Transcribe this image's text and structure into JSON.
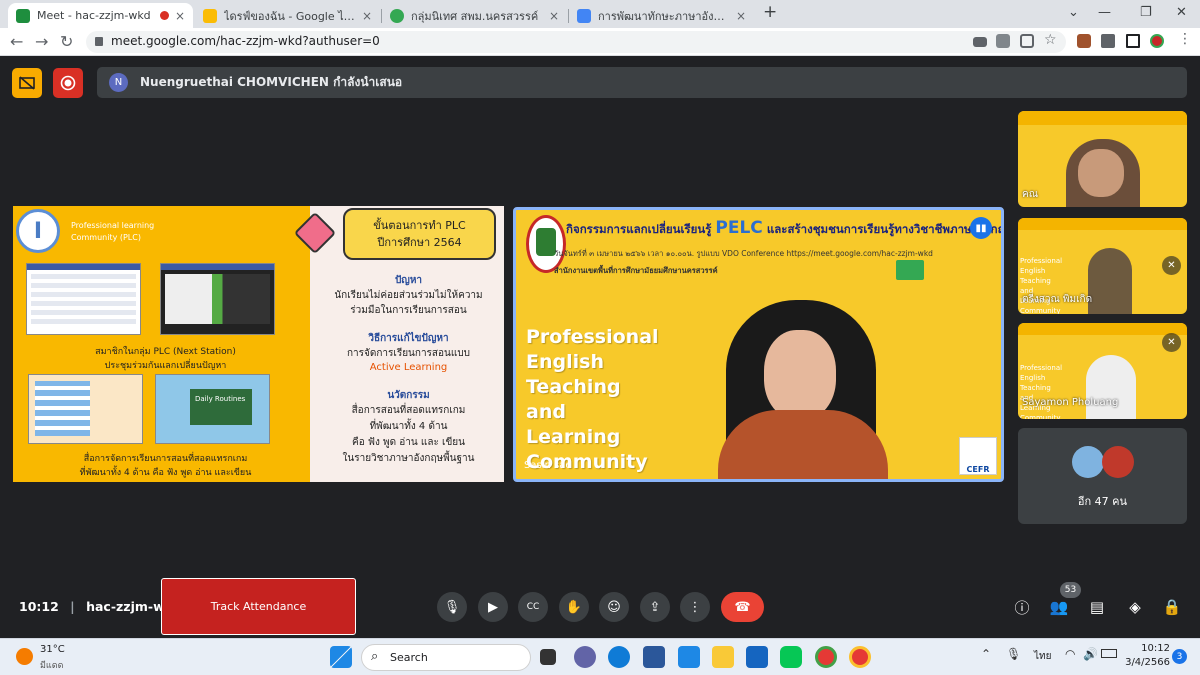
{
  "browser": {
    "tabs": [
      {
        "title": "Meet - hac-zzjm-wkd",
        "active": true,
        "color": "#1e8e3e"
      },
      {
        "title": "ไดรฟ์ของฉัน - Google ไดรฟ์",
        "active": false,
        "color": "#fbbc04"
      },
      {
        "title": "กลุ่มนิเทศ สพม.นครสวรรค์",
        "active": false,
        "color": "#34a853"
      },
      {
        "title": "การพัฒนาทักษะภาษาอังกฤษ English",
        "active": false,
        "color": "#4285f4"
      }
    ],
    "new_tab": "+",
    "close": "×",
    "url": "meet.google.com/hac-zzjm-wkd?authuser=0"
  },
  "meet": {
    "presenter_initial": "N",
    "presenter_text": "Nuengruethai CHOMVICHEN กำลังนำเสนอ",
    "slide": {
      "logo_letter": "I",
      "plc_title": "Professional learning Community (PLC)",
      "caption1": "สมาชิกในกลุ่ม PLC (Next Station)\nประชุมร่วมกันแลกเปลี่ยนปัญหา",
      "caption2": "สื่อการจัดการเรียนการสอนที่สอดแทรกเกม\nที่พัฒนาทั้ง 4 ด้าน คือ ฟัง พูด อ่าน และเขียน",
      "banner": "ขั้นตอนการทำ PLC\nปีการศึกษา 2564",
      "problem_h": "ปัญหา",
      "problem": "นักเรียนไม่ค่อยส่วนร่วมไม่ให้ความ\nร่วมมือในการเรียนการสอน",
      "solution_h": "วิธีการแก้ไขปัญหา",
      "solution": "การจัดการเรียนการสอนแบบ",
      "active_learning": "Active Learning",
      "innovation_h": "นวัตกรรม",
      "innovation": "สื่อการสอนที่สอดแทรกเกม\nที่พัฒนาทั้ง 4 ด้าน\nคือ ฟัง พูด อ่าน และ เขียน\nในรายวิชาภาษาอังกฤษพื้นฐาน",
      "daily": "Daily Routines"
    },
    "main_video": {
      "title_a": "กิจกรรมการแลกเปลี่ยนเรียนรู้",
      "title_pelc": "PELC",
      "title_b": "และสร้างชุมชนการเรียนรู้ทางวิชาชีพภาษาอังกฤษ",
      "date_line": "วันจันทร์ที่ ๓ เมษายน ๒๕๖๖ เวลา ๑๐.๐๐น. รูปแบบ VDO Conference https://meet.google.com/hac-zzjm-wkd",
      "org_line": "สำนักงานเขตพื้นที่การศึกษามัธยมศึกษานครสวรรค์",
      "big_text": "Professional\nEnglish\nTeaching\nand\nLearning\nCommunity",
      "name": "Sasin sae",
      "cefr": "CEFR"
    },
    "tiles": [
      {
        "name": "คณ",
        "muted": false
      },
      {
        "name": "ตรีงสวณ พิมเกิด",
        "muted": true
      },
      {
        "name": "Sayamon Pholuang",
        "muted": true
      }
    ],
    "tile_small_text": "Professional\nEnglish\nTeaching\nand\nLearning\nCommunity",
    "others": "อีก 47 คน"
  },
  "controls": {
    "time": "10:12",
    "meeting_code": "hac-zzjm-wkd",
    "track": "Track Attendance",
    "participant_count": "53"
  },
  "taskbar": {
    "temp": "31°C",
    "weather": "มีแดด",
    "search": "Search",
    "lang": "ไทย",
    "time": "10:12",
    "date": "3/4/2566",
    "badge": "3"
  }
}
